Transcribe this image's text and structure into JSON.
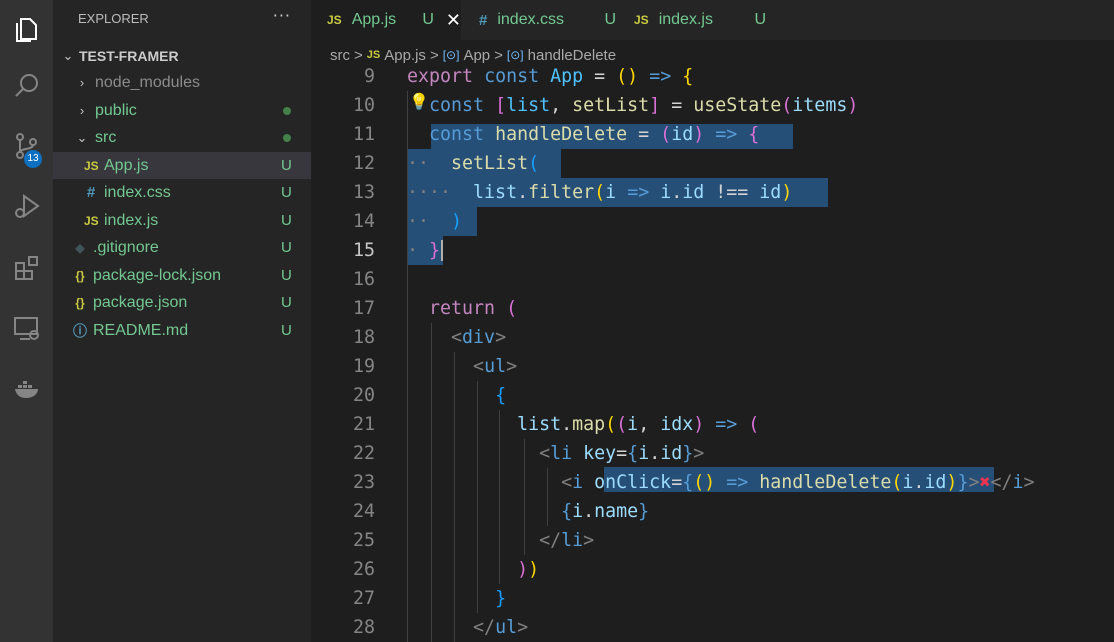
{
  "activity_bar": {
    "badge": "13",
    "icons": [
      "explorer-icon",
      "search-icon",
      "source-control-icon",
      "run-debug-icon",
      "extensions-icon",
      "remote-explorer-icon",
      "docker-icon"
    ]
  },
  "sidebar": {
    "header": "EXPLORER",
    "more": "···",
    "root": "TEST-FRAMER",
    "items": [
      {
        "name": "node_modules",
        "status": ""
      },
      {
        "name": "public",
        "status": ""
      },
      {
        "name": "src",
        "status": ""
      },
      {
        "name": "App.js",
        "status": "U",
        "icon": "JS"
      },
      {
        "name": "index.css",
        "status": "U",
        "icon": "#"
      },
      {
        "name": "index.js",
        "status": "U",
        "icon": "JS"
      },
      {
        "name": ".gitignore",
        "status": "U",
        "icon": "◆"
      },
      {
        "name": "package-lock.json",
        "status": "U",
        "icon": "{}"
      },
      {
        "name": "package.json",
        "status": "U",
        "icon": "{}"
      },
      {
        "name": "README.md",
        "status": "U",
        "icon": "ⓘ"
      }
    ]
  },
  "tabs": [
    {
      "icon": "JS",
      "label": "App.js",
      "status": "U",
      "close": "✕"
    },
    {
      "icon": "#",
      "label": "index.css",
      "status": "U"
    },
    {
      "icon": "JS",
      "label": "index.js",
      "status": "U"
    }
  ],
  "breadcrumb": {
    "folder": "src",
    "sep": ">",
    "file": "App.js",
    "sym1": "App",
    "sym2": "handleDelete"
  },
  "code": {
    "line_numbers": [
      "9",
      "10",
      "11",
      "12",
      "13",
      "14",
      "15",
      "16",
      "17",
      "18",
      "19",
      "20",
      "21",
      "22",
      "23",
      "24",
      "25",
      "26",
      "27",
      "28"
    ],
    "lines": [
      "export const App = () => {",
      "  const [list, setList] = useState(items)",
      "  const handleDelete = (id) => {",
      "    setList(",
      "      list.filter(i => i.id !== id)",
      "    )",
      "  }",
      "",
      "  return (",
      "    <div>",
      "      <ul>",
      "        {",
      "          list.map((i, idx) => (",
      "            <li key={i.id}>",
      "              <i onClick={() => handleDelete(i.id)}>❌</i>",
      "              {i.name}",
      "            </li>",
      "          ))",
      "        }",
      "      </ul>"
    ]
  }
}
